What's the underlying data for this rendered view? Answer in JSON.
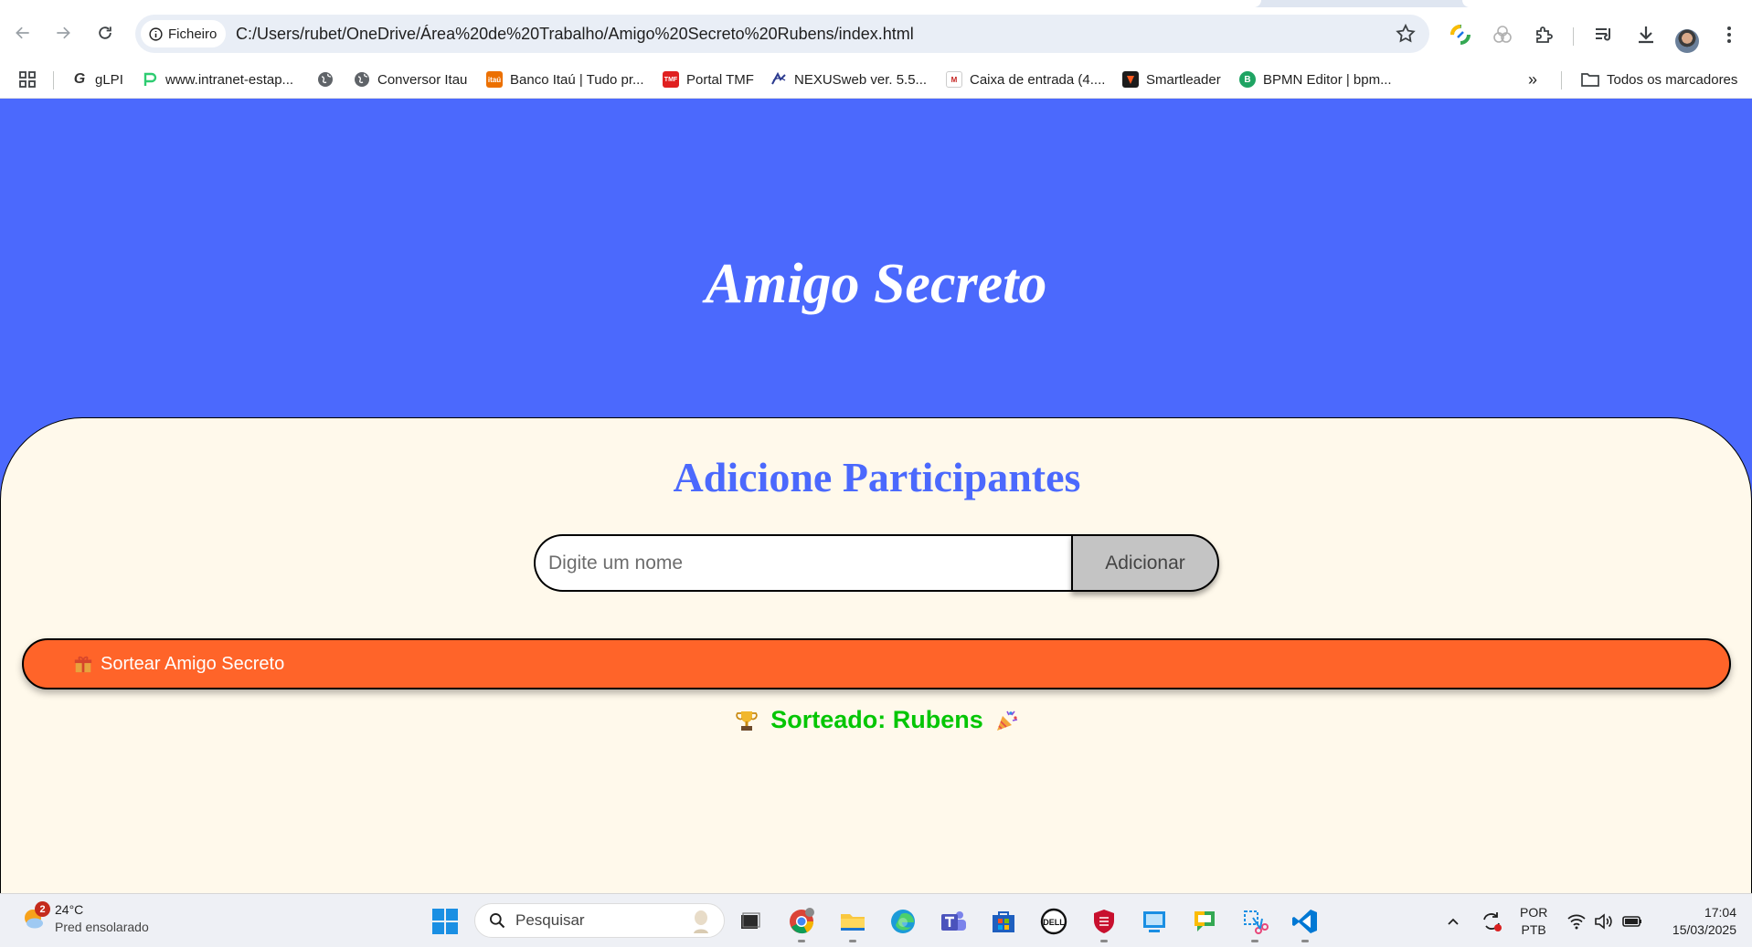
{
  "browser": {
    "site_chip_label": "Ficheiro",
    "url": "C:/Users/rubet/OneDrive/Área%20de%20Trabalho/Amigo%20Secreto%20Rubens/index.html",
    "bookmarks": [
      {
        "label": "gLPI",
        "icon": "glpi-icon"
      },
      {
        "label": "www.intranet-estap...",
        "icon": "intranet-icon"
      },
      {
        "label": "",
        "icon": "globe-icon"
      },
      {
        "label": "Conversor Itau",
        "icon": "globe-icon"
      },
      {
        "label": "Banco Itaú | Tudo pr...",
        "icon": "itau-icon"
      },
      {
        "label": "Portal TMF",
        "icon": "tmf-icon"
      },
      {
        "label": "NEXUSweb ver. 5.5...",
        "icon": "nexus-icon"
      },
      {
        "label": "Caixa de entrada (4....",
        "icon": "gmail-icon"
      },
      {
        "label": "Smartleader",
        "icon": "smartleader-icon"
      },
      {
        "label": "BPMN Editor | bpm...",
        "icon": "bpmn-icon"
      }
    ],
    "all_bookmarks_label": "Todos os marcadores"
  },
  "page": {
    "banner_title": "Amigo Secreto",
    "section_title": "Adicione Participantes",
    "input_placeholder": "Digite um nome",
    "add_button_label": "Adicionar",
    "draw_button_label": "Sortear Amigo Secreto",
    "result_text": "Sorteado: Rubens",
    "colors": {
      "banner": "#4b69fd",
      "card": "#fff9eb",
      "title": "#4b69fd",
      "draw_button": "#ff6429",
      "result": "#05c605",
      "add_button": "#c4c4c4"
    }
  },
  "taskbar": {
    "weather_badge": "2",
    "temperature": "24°C",
    "weather_desc": "Pred ensolarado",
    "search_placeholder": "Pesquisar",
    "lang_top": "POR",
    "lang_bottom": "PTB",
    "time": "17:04",
    "date": "15/03/2025"
  }
}
